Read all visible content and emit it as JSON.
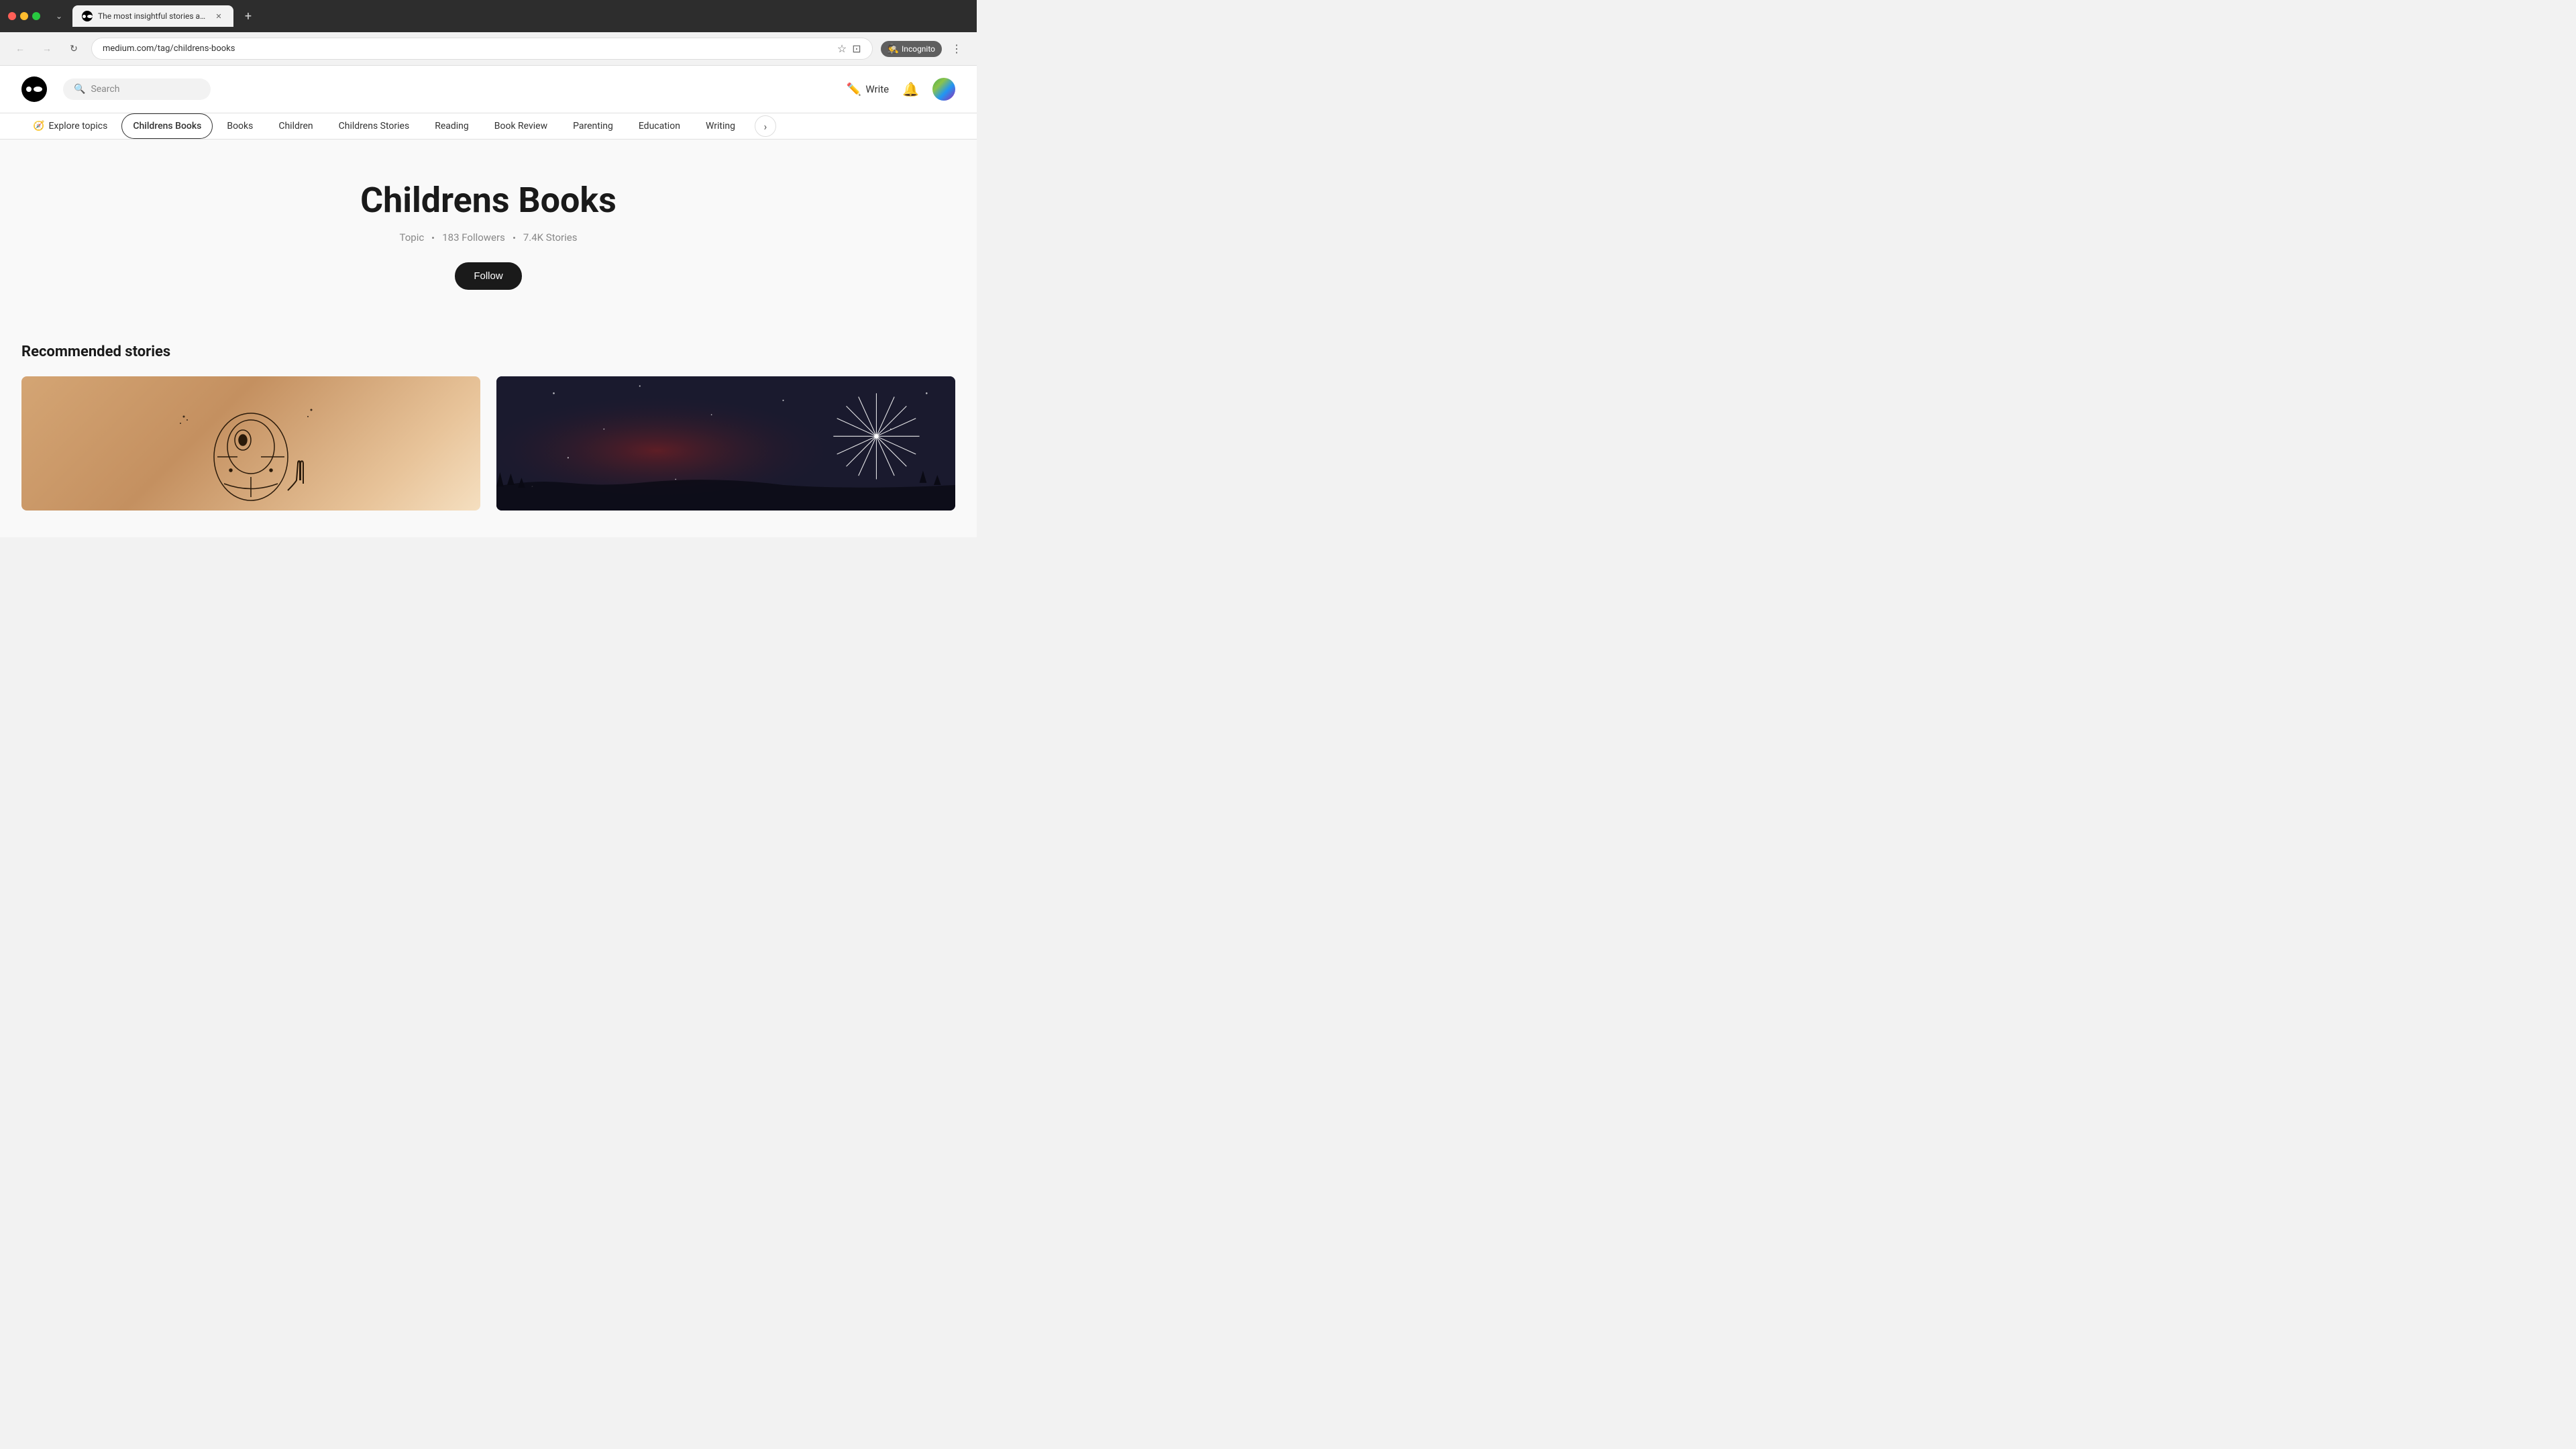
{
  "browser": {
    "tab": {
      "title": "The most insightful stories abo...",
      "favicon_alt": "medium-favicon"
    },
    "address": {
      "url": "medium.com/tag/childrens-books",
      "back_label": "←",
      "forward_label": "→",
      "reload_label": "↻"
    },
    "actions": {
      "bookmark_label": "☆",
      "profile_label": "⊡",
      "incognito_label": "Incognito",
      "more_label": "⋮"
    }
  },
  "header": {
    "logo_alt": "Medium logo",
    "search_placeholder": "Search",
    "write_label": "Write",
    "notification_label": "🔔",
    "avatar_alt": "User avatar"
  },
  "topics": {
    "explore_label": "Explore topics",
    "chips": [
      {
        "label": "Childrens Books",
        "active": true
      },
      {
        "label": "Books",
        "active": false
      },
      {
        "label": "Children",
        "active": false
      },
      {
        "label": "Childrens Stories",
        "active": false
      },
      {
        "label": "Reading",
        "active": false
      },
      {
        "label": "Book Review",
        "active": false
      },
      {
        "label": "Parenting",
        "active": false
      },
      {
        "label": "Education",
        "active": false
      },
      {
        "label": "Writing",
        "active": false
      }
    ],
    "scroll_right_label": "›"
  },
  "hero": {
    "title": "Childrens Books",
    "meta_type": "Topic",
    "meta_followers": "183 Followers",
    "meta_stories": "7.4K Stories",
    "follow_label": "Follow"
  },
  "recommended": {
    "section_title": "Recommended stories",
    "stories": [
      {
        "id": "story-1",
        "image_alt": "Hand drawing sketch on paper"
      },
      {
        "id": "story-2",
        "image_alt": "Dark sky with starburst light"
      }
    ]
  }
}
